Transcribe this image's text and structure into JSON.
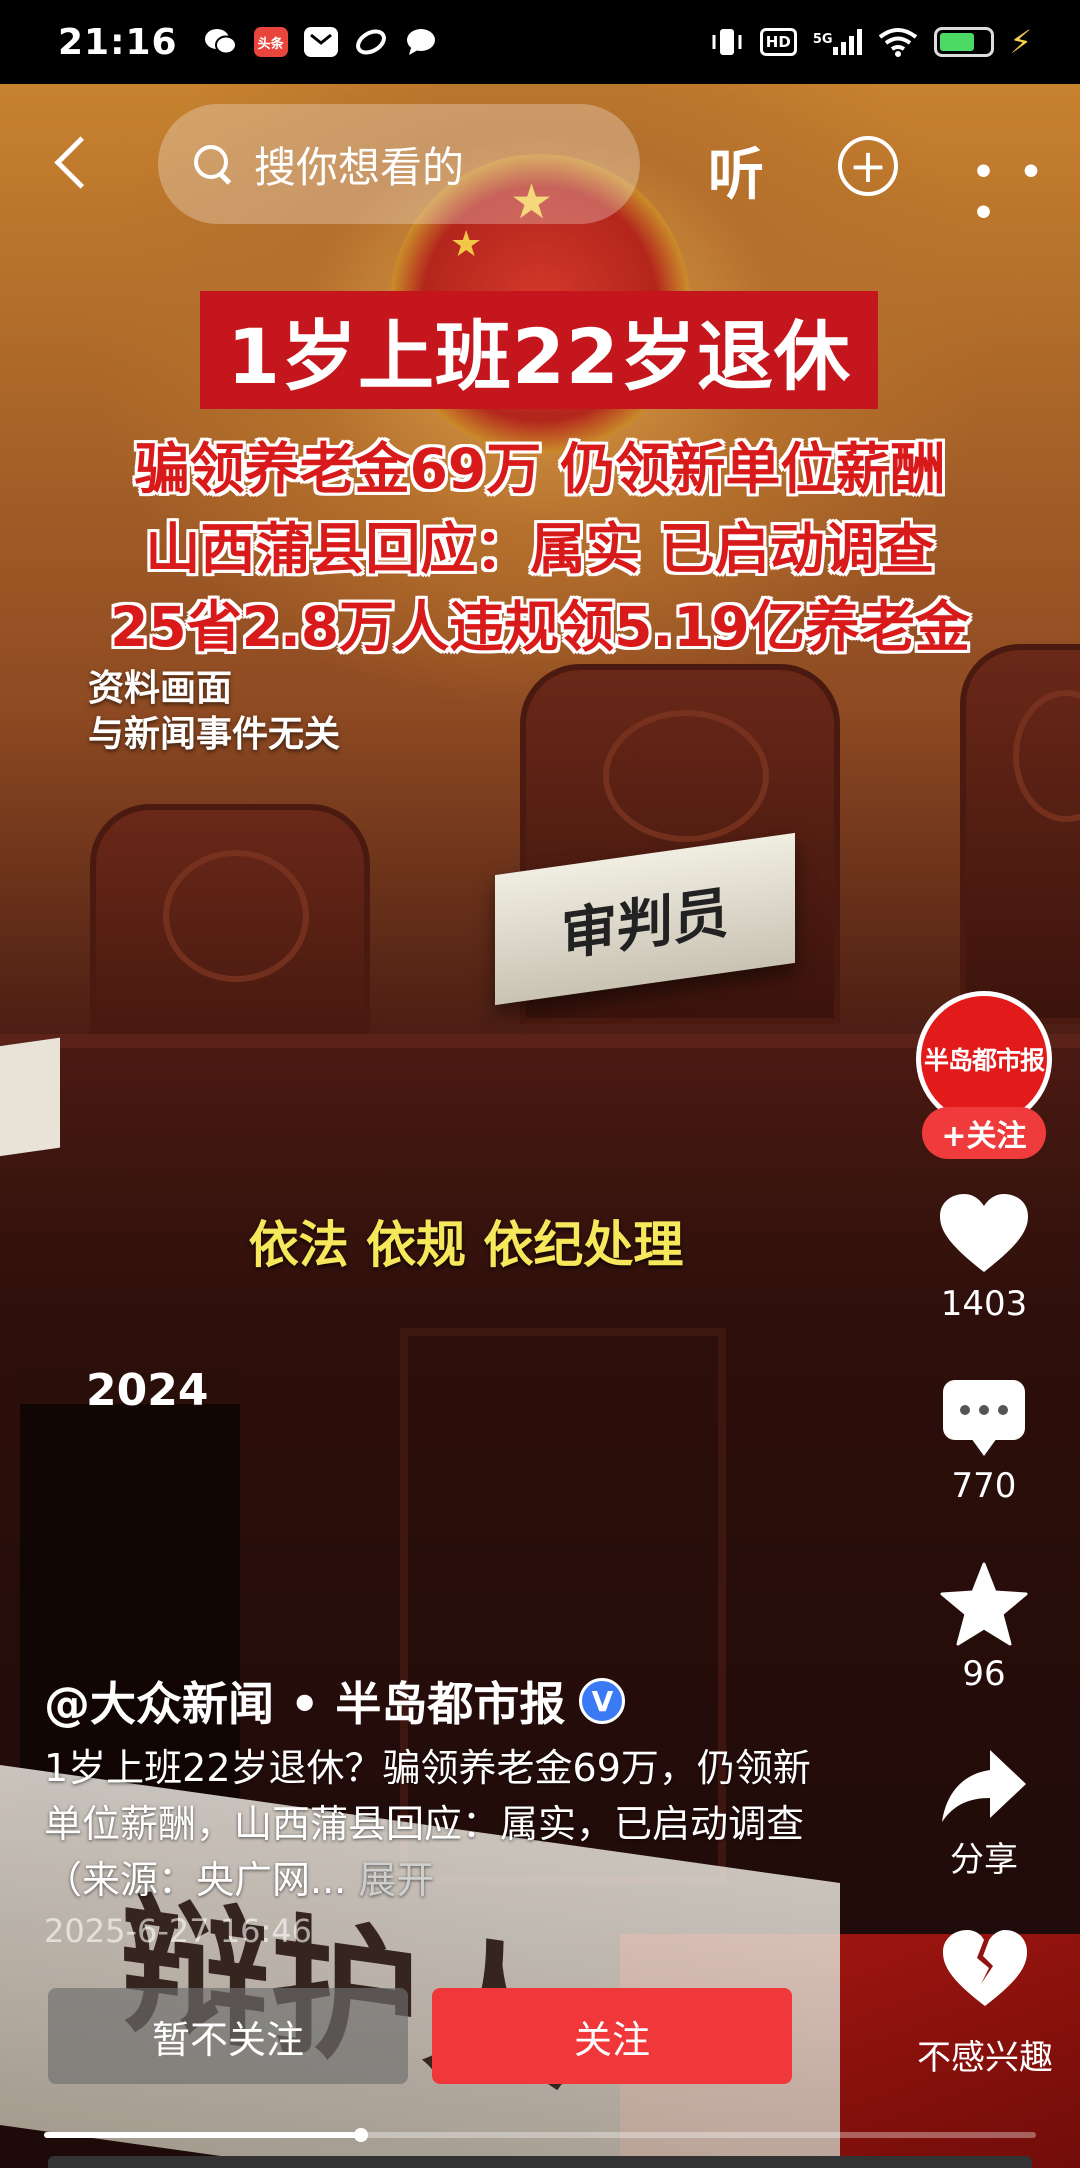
{
  "status_bar": {
    "time": "21:16",
    "app_icons": [
      "wechat-icon",
      "toutiao-icon",
      "mail-icon",
      "link-icon",
      "chat-icon"
    ],
    "toutiao_label": "头条",
    "hd": "HD",
    "network": "5G",
    "battery_percent": 72
  },
  "nav": {
    "search_placeholder": "搜你想看的",
    "listen_label": "听",
    "more_label": "• • •"
  },
  "video": {
    "headline": "1岁上班22岁退休",
    "lines": [
      "骗领养老金69万 仍领新单位薪酬",
      "山西蒲县回应：属实 已启动调查",
      "25省2.8万人违规领5.19亿养老金"
    ],
    "disclaimer": [
      "资料画面",
      "与新闻事件无关"
    ],
    "nameplate": "审判员",
    "caption": "依法 依规 依纪处理",
    "year": "2024",
    "bottom_plate": "辩护人"
  },
  "actions": {
    "avatar_text": "半岛都市报",
    "follow_pill": "+关注",
    "likes": "1403",
    "comments": "770",
    "favorites": "96",
    "share": "分享",
    "not_interested": "不感兴趣"
  },
  "post": {
    "author": "@大众新闻 • 半岛都市报",
    "verified_label": "V",
    "description": "1岁上班22岁退休？骗领养老金69万，仍领新单位薪酬，山西蒲县回应：属实，已启动调查（来源：央广网...",
    "expand": "展开",
    "timestamp": "2025-6-27 16:46"
  },
  "buttons": {
    "not_follow": "暂不关注",
    "follow": "关注"
  },
  "progress": {
    "fraction": 0.32
  },
  "colors": {
    "accent_red": "#f0383b",
    "verified_blue": "#3a7bf5",
    "caption_yellow": "#f6e85a"
  }
}
